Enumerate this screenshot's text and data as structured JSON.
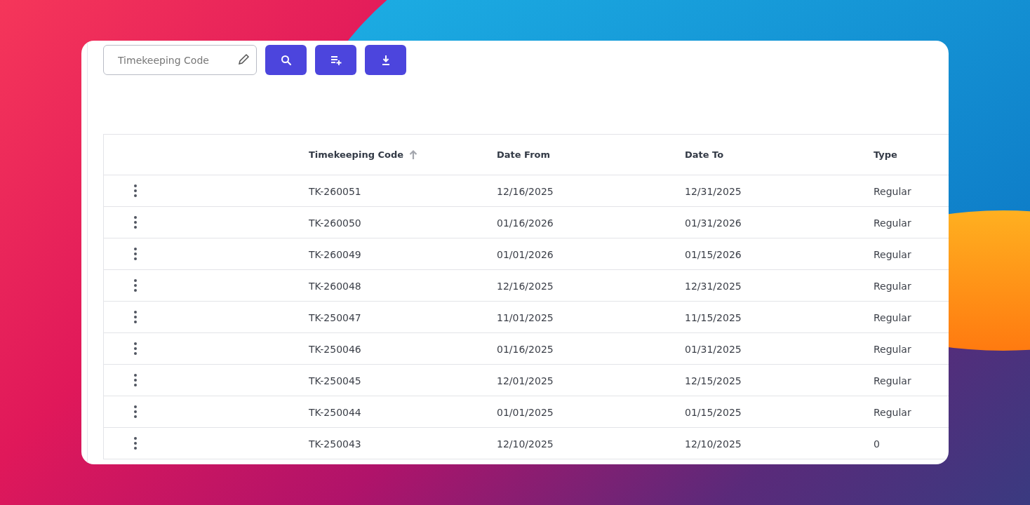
{
  "toolbar": {
    "search": {
      "placeholder": "Timekeeping Code"
    },
    "buttons": [
      {
        "kind": "search"
      },
      {
        "kind": "add-list"
      },
      {
        "kind": "download"
      }
    ]
  },
  "table": {
    "columns": [
      {
        "label": "Timekeeping Code",
        "sort_ascending": true
      },
      {
        "label": "Date From",
        "sort_ascending": false
      },
      {
        "label": "Date To",
        "sort_ascending": false
      },
      {
        "label": "Type",
        "sort_ascending": false
      }
    ],
    "rows": [
      [
        "TK-260051",
        "12/16/2025",
        "12/31/2025",
        "Regular"
      ],
      [
        "TK-260050",
        "01/16/2026",
        "01/31/2026",
        "Regular"
      ],
      [
        "TK-260049",
        "01/01/2026",
        "01/15/2026",
        "Regular"
      ],
      [
        "TK-260048",
        "12/16/2025",
        "12/31/2025",
        "Regular"
      ],
      [
        "TK-250047",
        "11/01/2025",
        "11/15/2025",
        "Regular"
      ],
      [
        "TK-250046",
        "01/16/2025",
        "01/31/2025",
        "Regular"
      ],
      [
        "TK-250045",
        "12/01/2025",
        "12/15/2025",
        "Regular"
      ],
      [
        "TK-250044",
        "01/01/2025",
        "01/15/2025",
        "Regular"
      ],
      [
        "TK-250043",
        "12/10/2025",
        "12/10/2025",
        "0"
      ]
    ]
  }
}
